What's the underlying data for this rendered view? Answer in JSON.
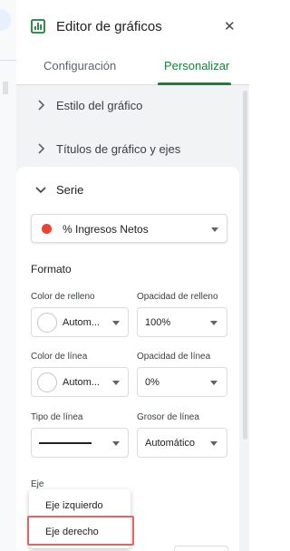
{
  "header": {
    "title": "Editor de gráficos",
    "close_icon": "close-icon",
    "chart_icon": "chart-icon"
  },
  "tabs": [
    {
      "label": "Configuración",
      "active": false
    },
    {
      "label": "Personalizar",
      "active": true
    }
  ],
  "accent_color": "#188038",
  "sections": [
    {
      "label": "Estilo del gráfico",
      "expanded": false
    },
    {
      "label": "Títulos de gráfico y ejes",
      "expanded": false
    }
  ],
  "serie": {
    "label": "Serie",
    "expanded": true,
    "selected_series": "% Ingresos Netos",
    "series_color": "#ea4335"
  },
  "formato": {
    "heading": "Formato",
    "fill_color_label": "Color de relleno",
    "fill_color_value": "Autom...",
    "fill_opacity_label": "Opacidad de relleno",
    "fill_opacity_value": "100%",
    "line_color_label": "Color de línea",
    "line_color_value": "Autom...",
    "line_opacity_label": "Opacidad de línea",
    "line_opacity_value": "0%",
    "line_type_label": "Tipo de línea",
    "line_width_label": "Grosor de línea",
    "line_width_value": "Automático"
  },
  "eje": {
    "label": "Eje",
    "options": [
      "Eje izquierdo",
      "Eje derecho"
    ],
    "highlighted_option": "Eje derecho",
    "highlight_color": "#e06666"
  }
}
